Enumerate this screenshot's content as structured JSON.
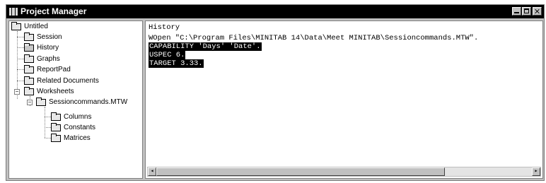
{
  "window": {
    "title": "Project Manager"
  },
  "tree": {
    "root": "Untitled",
    "items": {
      "session": "Session",
      "history": "History",
      "graphs": "Graphs",
      "reportpad": "ReportPad",
      "related_documents": "Related Documents",
      "worksheets": "Worksheets",
      "worksheet_file": "Sessioncommands.MTW",
      "columns": "Columns",
      "constants": "Constants",
      "matrices": "Matrices"
    },
    "selected": "History",
    "toggles": {
      "worksheets": "−",
      "worksheet_file": "−"
    }
  },
  "history": {
    "title": "History",
    "lines": [
      "WOpen \"C:\\Program Files\\MINITAB 14\\Data\\Meet MINITAB\\Sessioncommands.MTW\".",
      "CAPABILITY 'Days' 'Date'.",
      "USPEC 6.",
      "TARGET 3.33."
    ],
    "highlighted_lines": [
      1,
      2,
      3
    ]
  },
  "scrollbar": {
    "left_arrow": "◂",
    "right_arrow": "▸"
  }
}
